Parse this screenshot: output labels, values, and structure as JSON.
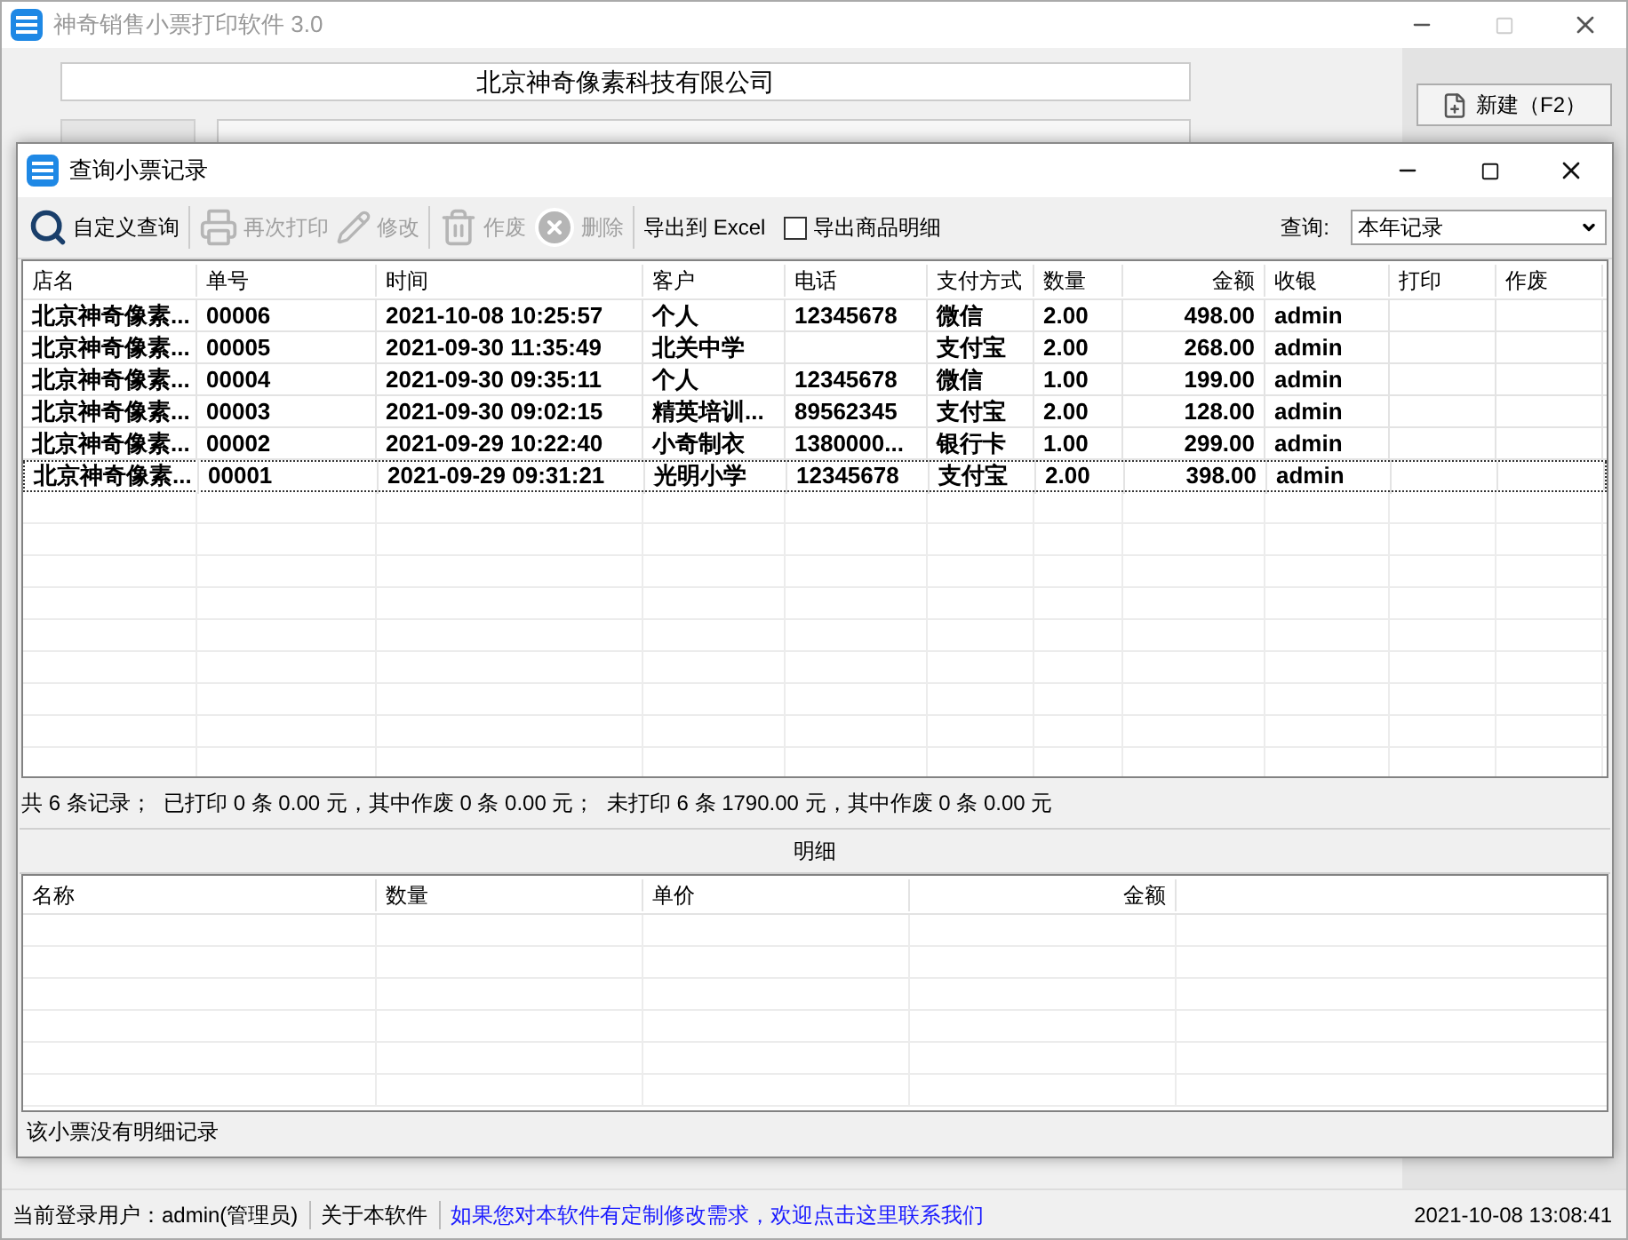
{
  "app_window": {
    "title": "神奇销售小票打印软件 3.0",
    "company": "北京神奇像素科技有限公司",
    "new_button": "新建（F2）"
  },
  "dialog": {
    "title": "查询小票记录",
    "toolbar": [
      {
        "kind": "search",
        "label": "自定义查询",
        "disabled": false
      },
      {
        "kind": "print",
        "label": "再次打印",
        "disabled": true
      },
      {
        "kind": "edit",
        "label": "修改",
        "disabled": true
      },
      {
        "kind": "trash",
        "label": "作废",
        "disabled": true
      },
      {
        "kind": "delete",
        "label": "删除",
        "disabled": true
      },
      {
        "kind": "plain",
        "label": "导出到 Excel",
        "disabled": false
      }
    ],
    "export_detail": {
      "label": "导出商品明细",
      "checked": false
    },
    "query_label": "查询:",
    "query_value": "本年记录"
  },
  "records": {
    "columns": [
      "店名",
      "单号",
      "时间",
      "客户",
      "电话",
      "支付方式",
      "数量",
      "金额",
      "收银",
      "打印",
      "作废"
    ],
    "rows": [
      {
        "focused": false,
        "cells": [
          "北京神奇像素...",
          "00006",
          "2021-10-08 10:25:57",
          "个人",
          "12345678",
          "微信",
          "2.00",
          "498.00",
          "admin",
          "",
          ""
        ]
      },
      {
        "focused": false,
        "cells": [
          "北京神奇像素...",
          "00005",
          "2021-09-30 11:35:49",
          "北关中学",
          "",
          "支付宝",
          "2.00",
          "268.00",
          "admin",
          "",
          ""
        ]
      },
      {
        "focused": false,
        "cells": [
          "北京神奇像素...",
          "00004",
          "2021-09-30 09:35:11",
          "个人",
          "12345678",
          "微信",
          "1.00",
          "199.00",
          "admin",
          "",
          ""
        ]
      },
      {
        "focused": false,
        "cells": [
          "北京神奇像素...",
          "00003",
          "2021-09-30 09:02:15",
          "精英培训...",
          "89562345",
          "支付宝",
          "2.00",
          "128.00",
          "admin",
          "",
          ""
        ]
      },
      {
        "focused": false,
        "cells": [
          "北京神奇像素...",
          "00002",
          "2021-09-29 10:22:40",
          "小奇制衣",
          "1380000...",
          "银行卡",
          "1.00",
          "299.00",
          "admin",
          "",
          ""
        ]
      },
      {
        "focused": true,
        "cells": [
          "北京神奇像素...",
          "00001",
          "2021-09-29 09:31:21",
          "光明小学",
          "12345678",
          "支付宝",
          "2.00",
          "398.00",
          "admin",
          "",
          ""
        ]
      }
    ]
  },
  "summary": "共 6 条记录；  已打印 0 条 0.00 元，其中作废 0 条 0.00 元；  未打印 6 条 1790.00 元，其中作废 0 条 0.00 元",
  "detail": {
    "title": "明细",
    "columns": [
      "名称",
      "数量",
      "单价",
      "金额"
    ],
    "status": "该小票没有明细记录"
  },
  "status_bar": {
    "user": "当前登录用户：admin(管理员)",
    "about": "关于本软件",
    "link": "如果您对本软件有定制修改需求，欢迎点击这里联系我们",
    "time": "2021-10-08 13:08:41"
  }
}
